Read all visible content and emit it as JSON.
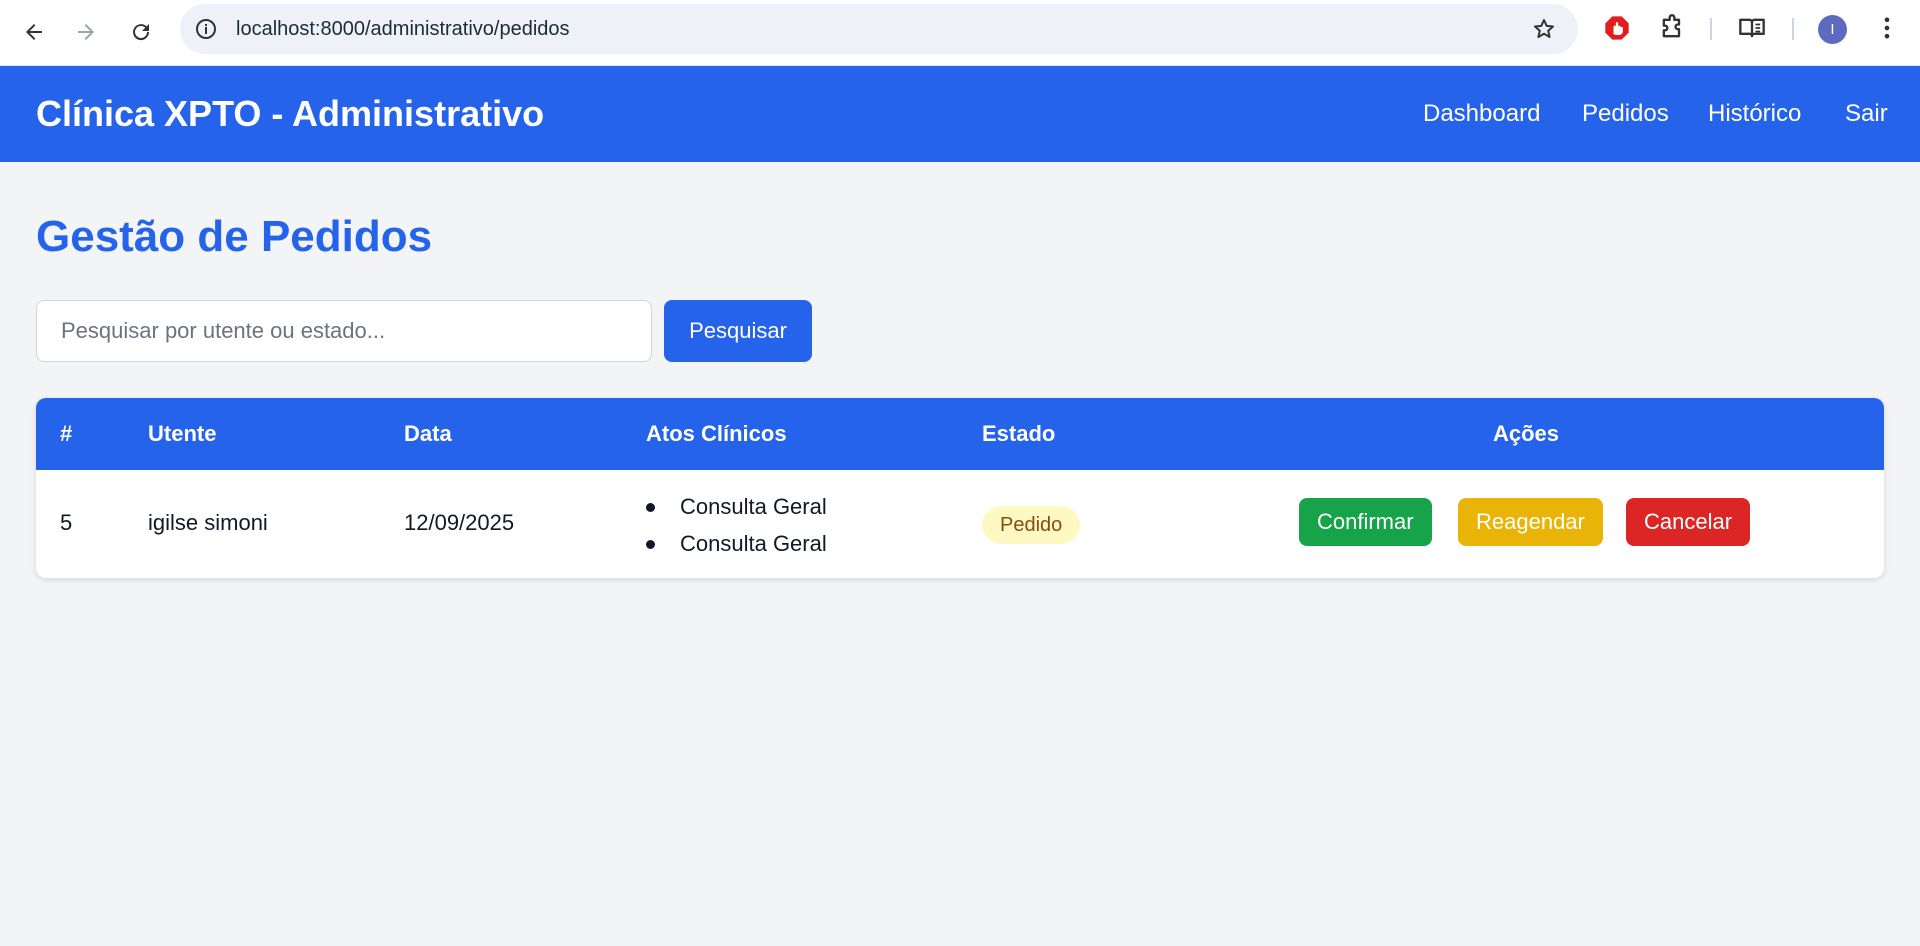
{
  "browser": {
    "url": "localhost:8000/administrativo/pedidos",
    "profile_initial": "I"
  },
  "header": {
    "brand": "Clínica XPTO - Administrativo",
    "nav": [
      {
        "label": "Dashboard"
      },
      {
        "label": "Pedidos"
      },
      {
        "label": "Histórico"
      },
      {
        "label": "Sair"
      }
    ]
  },
  "main": {
    "title": "Gestão de Pedidos",
    "search": {
      "placeholder": "Pesquisar por utente ou estado...",
      "value": "",
      "button_label": "Pesquisar"
    },
    "table": {
      "columns": [
        "#",
        "Utente",
        "Data",
        "Atos Clínicos",
        "Estado",
        "Ações"
      ],
      "rows": [
        {
          "id": "5",
          "utente": "igilse simoni",
          "data": "12/09/2025",
          "atos": [
            "Consulta Geral",
            "Consulta Geral"
          ],
          "estado": "Pedido",
          "actions": {
            "confirm": "Confirmar",
            "reschedule": "Reagendar",
            "cancel": "Cancelar"
          }
        }
      ]
    }
  },
  "colors": {
    "primary": "#2563eb",
    "confirm": "#16a34a",
    "reschedule": "#eab308",
    "cancel": "#dc2626",
    "badge_bg": "#fef9c3",
    "badge_text": "#854d0e"
  }
}
